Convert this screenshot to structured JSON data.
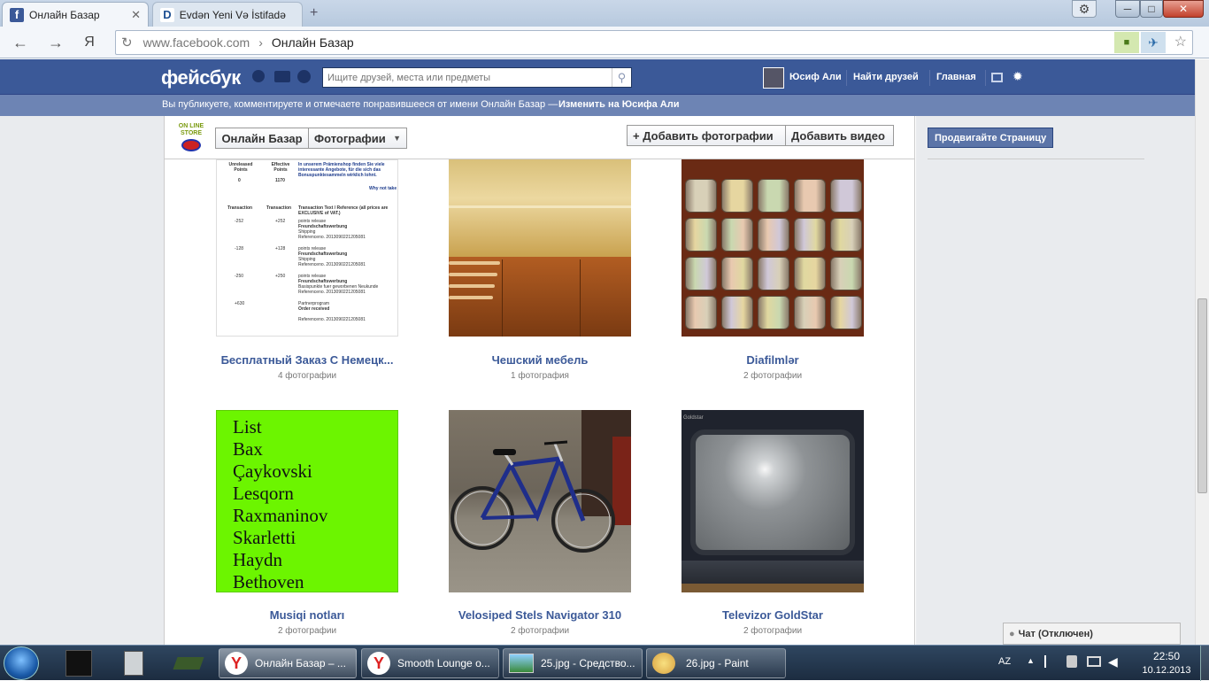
{
  "browser": {
    "tabs": [
      {
        "title": "Онлайн Базар",
        "favicon": "facebook-icon",
        "active": true
      },
      {
        "title": "Evdən Yeni Və İstifadə",
        "favicon": "d-icon",
        "active": false
      }
    ],
    "new_tab_symbol": "+",
    "back_symbol": "←",
    "forward_symbol": "→",
    "yandex_symbol": "Я",
    "reload_symbol": "↻",
    "url_domain": "www.facebook.com",
    "url_separator": "›",
    "url_page": "Онлайн Базар",
    "window_buttons": {
      "minimize": "─",
      "maximize": "□",
      "close": "✕"
    },
    "settings_symbol": "⚙",
    "lock_symbol": "🔒",
    "star_symbol": "☆"
  },
  "facebook": {
    "logo": "фейсбук",
    "search_placeholder": "Ищите друзей, места или предметы",
    "user_name": "Юсиф Али",
    "find_friends": "Найти друзей",
    "home": "Главная",
    "notice_text": "Вы публикуете, комментируете и отмечаете понравившееся от имени Онлайн Базар —",
    "notice_link": "Изменить на Юсифа Али",
    "colors": {
      "brand": "#3b5998",
      "sub": "#6d84b4"
    }
  },
  "page_header": {
    "page_name": "Онлайн Базар",
    "section": "Фотографии",
    "add_photos": "+ Добавить фотографии",
    "add_video": "Добавить видео",
    "promote": "Продвигайте Страницу"
  },
  "albums": [
    {
      "title": "Бесплатный Заказ С Немецк...",
      "count": "4 фотографии"
    },
    {
      "title": "Чешский мебель",
      "count": "1 фотография"
    },
    {
      "title": "Diafilmlər",
      "count": "2 фотографии"
    },
    {
      "title": "Musiqi notları",
      "count": "2 фотографии"
    },
    {
      "title": "Velosiped Stels Navigator 310",
      "count": "2 фотографии"
    },
    {
      "title": "Televizor GoldStar",
      "count": "2 фотографии"
    }
  ],
  "music_list": [
    "List",
    "Bax",
    "Çaykovski",
    "Lesqorn",
    "Raxmaninov",
    "Skarletti",
    "Haydn",
    "Bethoven"
  ],
  "document_thumb": {
    "h1": "Unreleased Points",
    "h2": "Effective Points",
    "val": "1170",
    "zero": "0",
    "intro": "In unserem Prämienshop finden Sie viele interessante Angebote, für die sich das Bonuspunktesammeln wirklich lohnt.",
    "why": "Why not take",
    "col_tx": "Transaction",
    "col_tx2": "Transaction",
    "col_text": "Transaction Text / Reference (all prices are EXCLUSIVE of VAT.)",
    "rows": [
      {
        "a": "-252",
        "b": "+252",
        "t1": "points release",
        "t2": "Freundschaftswerbung",
        "t3": "Shipping",
        "t4": "Referenceno. 2013090221205081"
      },
      {
        "a": "-128",
        "b": "+128",
        "t1": "points release",
        "t2": "Freundschaftswerbung",
        "t3": "Shipping",
        "t4": "Referenceno. 2013090221205081"
      },
      {
        "a": "-250",
        "b": "+250",
        "t1": "points release",
        "t2": "Freundschaftswerbung",
        "t3": "Basispunkte fuer geworbenen Neukunde",
        "t4": "Referenceno. 2013090221205081"
      },
      {
        "a": "+630",
        "b": "",
        "t1": "Partnerprogram",
        "t2": "Order received",
        "t3": "",
        "t4": "Referenceno. 2013090221205081"
      }
    ]
  },
  "tv_brand": "Goldstar",
  "chat": {
    "label": "Чат (Отключен)"
  },
  "taskbar": {
    "items": [
      {
        "label": "Онлайн Базар – ..."
      },
      {
        "label": "Smooth Lounge o..."
      },
      {
        "label": "25.jpg - Средство..."
      },
      {
        "label": "26.jpg - Paint"
      }
    ],
    "lang": "AZ",
    "time": "22:50",
    "date": "10.12.2013"
  }
}
